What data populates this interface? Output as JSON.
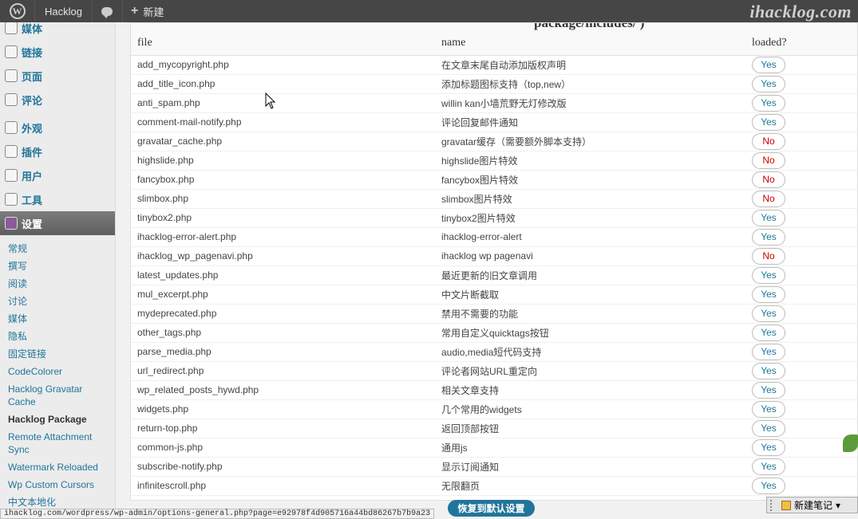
{
  "adminbar": {
    "wp_logo": "W",
    "site_name": "Hacklog",
    "new_label": "新建",
    "watermark": "ihacklog.com"
  },
  "sidebar": {
    "items": [
      {
        "label": "媒体",
        "icon": "media-icon"
      },
      {
        "label": "链接",
        "icon": "link-icon"
      },
      {
        "label": "页面",
        "icon": "page-icon"
      },
      {
        "label": "评论",
        "icon": "comment-icon"
      }
    ],
    "items2": [
      {
        "label": "外观",
        "icon": "appearance-icon"
      },
      {
        "label": "插件",
        "icon": "plugin-icon"
      },
      {
        "label": "用户",
        "icon": "users-icon"
      },
      {
        "label": "工具",
        "icon": "tools-icon"
      }
    ],
    "current": {
      "label": "设置",
      "icon": "settings-icon"
    },
    "submenu": [
      "常规",
      "撰写",
      "阅读",
      "讨论",
      "媒体",
      "隐私",
      "固定链接",
      "CodeColorer",
      "Hacklog Gravatar Cache",
      "Hacklog Package",
      "Remote Attachment Sync",
      "Watermark Reloaded",
      "Wp Custom Cursors",
      "中文本地化"
    ]
  },
  "main": {
    "cut_title": "package/includes/ )",
    "headers": {
      "file": "file",
      "name": "name",
      "loaded": "loaded?"
    },
    "rows": [
      {
        "file": "add_mycopyright.php",
        "name": "在文章末尾自动添加版权声明",
        "loaded": "Yes"
      },
      {
        "file": "add_title_icon.php",
        "name": "添加标题图标支持（top,new）",
        "loaded": "Yes"
      },
      {
        "file": "anti_spam.php",
        "name": "willin kan小墙荒野无灯修改版",
        "loaded": "Yes"
      },
      {
        "file": "comment-mail-notify.php",
        "name": "评论回复邮件通知",
        "loaded": "Yes"
      },
      {
        "file": "gravatar_cache.php",
        "name": "gravatar缓存（需要额外脚本支持）",
        "loaded": "No"
      },
      {
        "file": "highslide.php",
        "name": "highslide图片特效",
        "loaded": "No"
      },
      {
        "file": "fancybox.php",
        "name": "fancybox图片特效",
        "loaded": "No"
      },
      {
        "file": "slimbox.php",
        "name": "slimbox图片特效",
        "loaded": "No"
      },
      {
        "file": "tinybox2.php",
        "name": "tinybox2图片特效",
        "loaded": "Yes"
      },
      {
        "file": "ihacklog-error-alert.php",
        "name": "ihacklog-error-alert",
        "loaded": "Yes"
      },
      {
        "file": "ihacklog_wp_pagenavi.php",
        "name": "ihacklog wp pagenavi",
        "loaded": "No"
      },
      {
        "file": "latest_updates.php",
        "name": "最近更新的旧文章调用",
        "loaded": "Yes"
      },
      {
        "file": "mul_excerpt.php",
        "name": "中文片断截取",
        "loaded": "Yes"
      },
      {
        "file": "mydeprecated.php",
        "name": "禁用不需要的功能",
        "loaded": "Yes"
      },
      {
        "file": "other_tags.php",
        "name": "常用自定义quicktags按钮",
        "loaded": "Yes"
      },
      {
        "file": "parse_media.php",
        "name": "audio,media短代码支持",
        "loaded": "Yes"
      },
      {
        "file": "url_redirect.php",
        "name": "评论者网站URL重定向",
        "loaded": "Yes"
      },
      {
        "file": "wp_related_posts_hywd.php",
        "name": "相关文章支持",
        "loaded": "Yes"
      },
      {
        "file": "widgets.php",
        "name": "几个常用的widgets",
        "loaded": "Yes"
      },
      {
        "file": "return-top.php",
        "name": "返回顶部按钮",
        "loaded": "Yes"
      },
      {
        "file": "common-js.php",
        "name": "通用js",
        "loaded": "Yes"
      },
      {
        "file": "subscribe-notify.php",
        "name": "显示订阅通知",
        "loaded": "Yes"
      },
      {
        "file": "infinitescroll.php",
        "name": "无限翻页",
        "loaded": "Yes"
      }
    ],
    "reset_label": "恢复到默认设置"
  },
  "statusbar": {
    "url": "ihacklog.com/wordpress/wp-admin/options-general.php?page=e92978f4d905716a44bd86267b7b9a23"
  },
  "note_widget": {
    "label": "新建笔记"
  }
}
